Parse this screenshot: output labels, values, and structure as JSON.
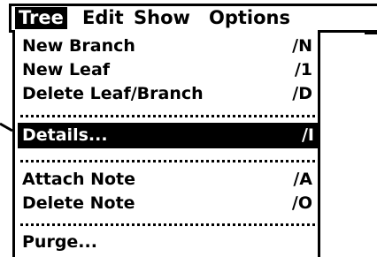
{
  "menubar": {
    "items": [
      {
        "label": "Tree",
        "active": true
      },
      {
        "label": "Edit",
        "active": false
      },
      {
        "label": "Show",
        "active": false
      },
      {
        "label": "Options",
        "active": false
      }
    ]
  },
  "menu": {
    "groups": [
      [
        {
          "label": "New Branch",
          "shortcut": "∕N"
        },
        {
          "label": "New Leaf",
          "shortcut": "∕1"
        },
        {
          "label": "Delete Leaf/Branch",
          "shortcut": "∕D"
        }
      ],
      [
        {
          "label": "Details...",
          "shortcut": "∕I",
          "selected": true
        }
      ],
      [
        {
          "label": "Attach Note",
          "shortcut": "∕A"
        },
        {
          "label": "Delete Note",
          "shortcut": "∕O"
        }
      ],
      [
        {
          "label": "Purge...",
          "shortcut": ""
        }
      ]
    ]
  },
  "colors": {
    "foreground": "#000000",
    "background": "#ffffff"
  }
}
